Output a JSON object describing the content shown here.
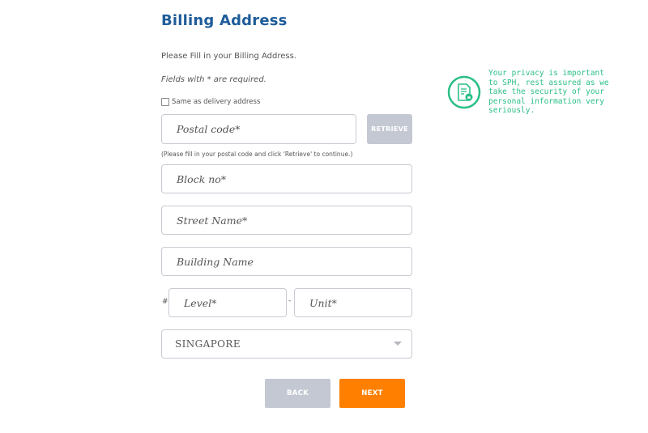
{
  "page": {
    "title": "Billing Address",
    "intro": "Please Fill in your Billing Address.",
    "required_note": "Fields with * are required."
  },
  "form": {
    "same_as_delivery": {
      "label": "Same as delivery address",
      "checked": false
    },
    "postal_code": {
      "placeholder": "Postal code*",
      "value": ""
    },
    "retrieve_label": "RETRIEVE",
    "postal_hint": "(Please fill in your postal code and click 'Retrieve' to continue.)",
    "block_no": {
      "placeholder": "Block no*",
      "value": ""
    },
    "street_name": {
      "placeholder": "Street Name*",
      "value": ""
    },
    "building_name": {
      "placeholder": "Building Name",
      "value": ""
    },
    "level_prefix": "#",
    "level": {
      "placeholder": "Level*",
      "value": ""
    },
    "unit_separator": "-",
    "unit": {
      "placeholder": "Unit*",
      "value": ""
    },
    "country": {
      "selected": "SINGAPORE"
    }
  },
  "actions": {
    "back_label": "BACK",
    "next_label": "NEXT"
  },
  "privacy": {
    "text": "Your privacy is important to SPH, rest assured as we take the security of your personal information very seriously.",
    "icon": "document-lock-icon"
  },
  "colors": {
    "title": "#1f5c99",
    "accent_orange": "#ff8000",
    "disabled_gray": "#c4c8d3",
    "privacy_green": "#2bbf86"
  }
}
